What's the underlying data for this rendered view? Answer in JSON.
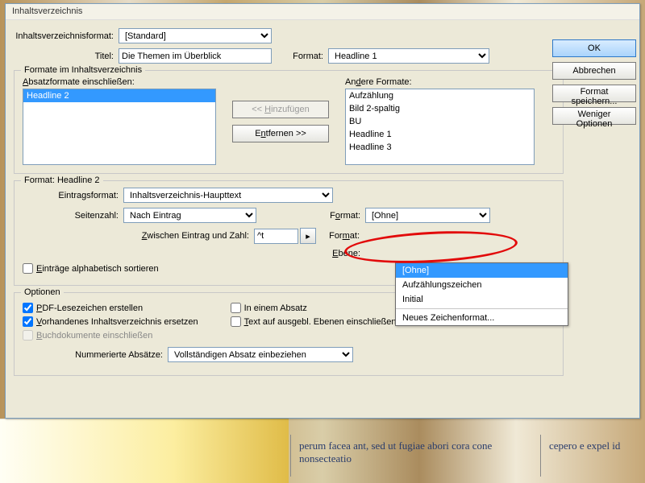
{
  "dialog": {
    "title": "Inhaltsverzeichnis",
    "tocFormatLabel": "Inhaltsverzeichnisformat:",
    "tocFormatValue": "[Standard]",
    "titleLabel": "Titel:",
    "titleValue": "Die Themen im Überblick",
    "formatLabel": "Format:",
    "formatValue": "Headline 1"
  },
  "formatsBox": {
    "legend": "Formate im Inhaltsverzeichnis",
    "includeLabel": "Absatzformate einschließen:",
    "includeItems": [
      "Headline 2"
    ],
    "otherLabel": "Andere Formate:",
    "otherItems": [
      "Aufzählung",
      "Bild 2-spaltig",
      "BU",
      "Headline 1",
      "Headline 3"
    ],
    "addBtn": "<< Hinzufügen",
    "removeBtn": "Entfernen >>"
  },
  "formatBox": {
    "legend": "Format: Headline 2",
    "entryFmtLabel": "Eintragsformat:",
    "entryFmtValue": "Inhaltsverzeichnis-Haupttext",
    "pageNumLabel": "Seitenzahl:",
    "pageNumValue": "Nach Eintrag",
    "betweenLabel": "Zwischen Eintrag und Zahl:",
    "betweenValue": "^t",
    "fmtLabel": "Format:",
    "fmtValue": "[Ohne]",
    "fmt2Label": "Format:",
    "levelLabel": "Ebene:",
    "sortAlphaLabel": "Einträge alphabetisch sortieren"
  },
  "dropdown": {
    "opt1": "[Ohne]",
    "opt2": "Aufzählungszeichen",
    "opt3": "Initial",
    "opt4": "Neues Zeichenformat..."
  },
  "options": {
    "legend": "Optionen",
    "pdfBm": "PDF-Lesezeichen erstellen",
    "replace": "Vorhandenes Inhaltsverzeichnis ersetzen",
    "bookdocs": "Buchdokumente einschließen",
    "oneParagraph": "In einem Absatz",
    "hiddenLayers": "Text auf ausgebl. Ebenen einschließen",
    "numParasLabel": "Nummerierte Absätze:",
    "numParasValue": "Vollständigen Absatz einbeziehen"
  },
  "sideButtons": {
    "ok": "OK",
    "cancel": "Abbrechen",
    "saveFmt": "Format speichern...",
    "fewer": "Weniger Optionen"
  },
  "bg": {
    "colA": "perum facea ant, sed ut fugiae abori cora cone nonsecteatio",
    "colB": "cepero e\nexpel id"
  }
}
